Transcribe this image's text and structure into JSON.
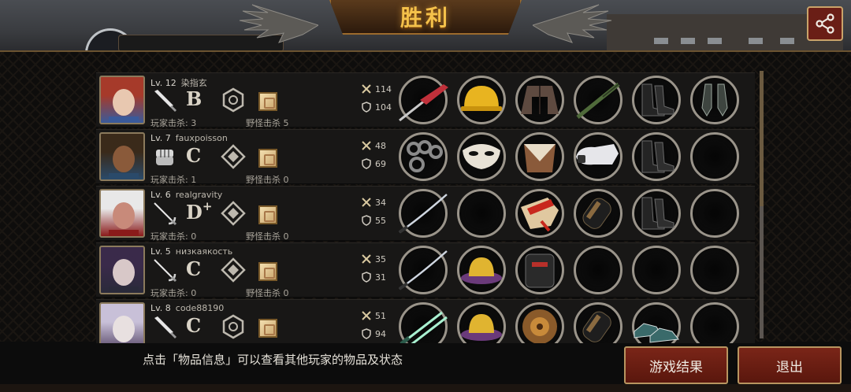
{
  "title": "胜利",
  "colors": {
    "accent_gold": "#f4c14a",
    "button_red": "#7a2518",
    "frame": "#9a948a"
  },
  "players": [
    {
      "level": "Lv. 12",
      "name": "染指玄",
      "weapon_icon": "knife-icon",
      "grade": "B",
      "grade_plus": "",
      "rank_icon": "hexagon-rank-icon",
      "player_kills": "玩家击杀: 3",
      "monster_kills": "野怪击杀 5",
      "attack": "114",
      "defense": "104",
      "items": [
        "red-blade-icon",
        "yellow-helmet-icon",
        "brown-jacket-icon",
        "green-rifle-icon",
        "black-boots-icon",
        "gloves-icon"
      ]
    },
    {
      "level": "Lv. 7",
      "name": "fauxpoisson",
      "weapon_icon": "fist-icon",
      "grade": "C",
      "grade_plus": "",
      "rank_icon": "diamond-rank-icon",
      "player_kills": "玩家击杀: 1",
      "monster_kills": "野怪击杀 0",
      "attack": "48",
      "defense": "69",
      "items": [
        "brass-knuckles-icon",
        "white-mask-icon",
        "leather-armor-icon",
        "white-gauntlet-icon",
        "black-boots-icon",
        "empty-slot"
      ]
    },
    {
      "level": "Lv. 6",
      "name": "realgravity",
      "weapon_icon": "rapier-icon",
      "grade": "D",
      "grade_plus": "+",
      "rank_icon": "diamond-rank-icon",
      "player_kills": "玩家击杀: 0",
      "monster_kills": "野怪击杀 0",
      "attack": "34",
      "defense": "55",
      "items": [
        "katana-icon",
        "empty-slot",
        "red-wrap-icon",
        "arm-guard-icon",
        "black-boots-icon",
        "empty-slot"
      ]
    },
    {
      "level": "Lv. 5",
      "name": "низкаякость",
      "weapon_icon": "rapier-icon",
      "grade": "C",
      "grade_plus": "",
      "rank_icon": "diamond-rank-icon",
      "player_kills": "玩家击杀: 0",
      "monster_kills": "野怪击杀 0",
      "attack": "35",
      "defense": "31",
      "items": [
        "katana-icon",
        "purple-hat-icon",
        "backpack-armor-icon",
        "empty-slot",
        "empty-slot",
        "empty-slot"
      ]
    },
    {
      "level": "Lv. 8",
      "name": "code88190",
      "weapon_icon": "knife-icon",
      "grade": "C",
      "grade_plus": "",
      "rank_icon": "hexagon-rank-icon",
      "player_kills": "",
      "monster_kills": "",
      "attack": "51",
      "defense": "94",
      "items": [
        "twin-blades-icon",
        "purple-hat-icon",
        "bronze-armor-icon",
        "arm-guard-icon",
        "sneakers-icon",
        "empty-slot"
      ]
    }
  ],
  "hint": "点击「物品信息」可以查看其他玩家的物品及状态",
  "buttons": {
    "result": "游戏结果",
    "exit": "退出"
  }
}
